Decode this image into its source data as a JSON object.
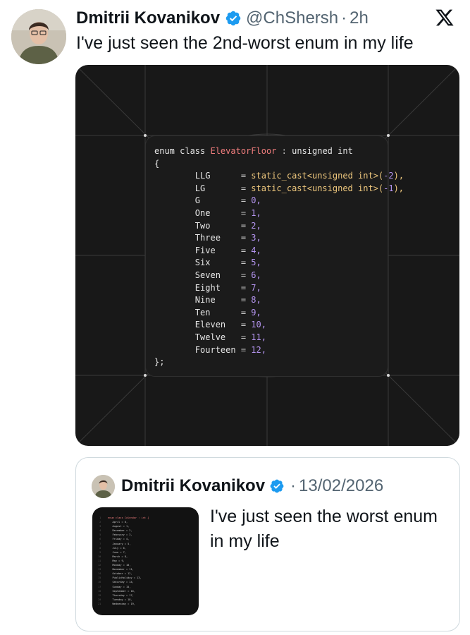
{
  "tweet": {
    "author_name": "Dmitrii Kovanikov",
    "handle": "@ChShersh",
    "separator": "·",
    "time": "2h",
    "text": "I've just seen the 2nd-worst enum in my life",
    "icons": {
      "avatar": "avatar",
      "verified": "verified-badge-icon",
      "platform": "x-logo-icon"
    }
  },
  "code_image": {
    "header_kw": "enum class",
    "header_type": "ElevatorFloor",
    "header_sep": ":",
    "header_base": "unsigned int",
    "open_brace": "{",
    "close_brace": "};",
    "entries": [
      {
        "name": "LLG",
        "value": "static_cast<unsigned int>(-2),",
        "cast": true,
        "num": "-2"
      },
      {
        "name": "LG",
        "value": "static_cast<unsigned int>(-1),",
        "cast": true,
        "num": "-1"
      },
      {
        "name": "G",
        "value": "0,",
        "cast": false,
        "num": "0"
      },
      {
        "name": "One",
        "value": "1,",
        "cast": false,
        "num": "1"
      },
      {
        "name": "Two",
        "value": "2,",
        "cast": false,
        "num": "2"
      },
      {
        "name": "Three",
        "value": "3,",
        "cast": false,
        "num": "3"
      },
      {
        "name": "Five",
        "value": "4,",
        "cast": false,
        "num": "4"
      },
      {
        "name": "Six",
        "value": "5,",
        "cast": false,
        "num": "5"
      },
      {
        "name": "Seven",
        "value": "6,",
        "cast": false,
        "num": "6"
      },
      {
        "name": "Eight",
        "value": "7,",
        "cast": false,
        "num": "7"
      },
      {
        "name": "Nine",
        "value": "8,",
        "cast": false,
        "num": "8"
      },
      {
        "name": "Ten",
        "value": "9,",
        "cast": false,
        "num": "9"
      },
      {
        "name": "Eleven",
        "value": "10,",
        "cast": false,
        "num": "10"
      },
      {
        "name": "Twelve",
        "value": "11,",
        "cast": false,
        "num": "11"
      },
      {
        "name": "Fourteen",
        "value": "12,",
        "cast": false,
        "num": "12"
      }
    ]
  },
  "quoted_tweet": {
    "author_name": "Dmitrii Kovanikov",
    "separator": "·",
    "date": "13/02/2026",
    "text": "I've just seen the worst enum in my life",
    "thumb_header": "enum class Calendar : int {",
    "thumb_entries": [
      "April = 0,",
      "August = 1,",
      "December = 2,",
      "February = 3,",
      "Friday = 4,",
      "January = 5,",
      "July = 6,",
      "June = 7,",
      "March = 8,",
      "May = 9,",
      "Monday = 10,",
      "November = 11,",
      "October = 12,",
      "PublicHoliday = 13,",
      "Saturday = 14,",
      "Sunday = 15,",
      "September = 16,",
      "Thursday = 17,",
      "Tuesday = 18,",
      "Wednesday = 19,"
    ]
  },
  "colors": {
    "text_primary": "#0f1419",
    "text_secondary": "#536471",
    "verified_blue": "#1d9bf0",
    "media_bg": "#181818",
    "code_type": "#f07d7d",
    "code_fn": "#f0c97e",
    "code_num": "#b696f2"
  }
}
